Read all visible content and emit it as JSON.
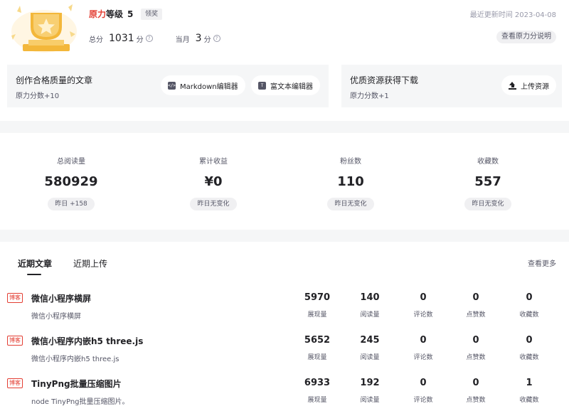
{
  "level": {
    "title_red": "原力",
    "title_rest": "等级",
    "level_num": "5",
    "badge": "领奖",
    "total_label": "总分",
    "total_value": "1031",
    "unit": "分",
    "month_label": "当月",
    "month_value": "3",
    "updated": "最近更新时间 2023-04-08",
    "explain_btn": "查看原力分说明",
    "help_icon": "?"
  },
  "tasks": [
    {
      "title": "创作合格质量的文章",
      "sub": "原力分数+10",
      "buttons": [
        {
          "label": "Markdown编辑器",
          "icon": "markdown-icon",
          "glyph": "</>"
        },
        {
          "label": "富文本编辑器",
          "icon": "richtext-icon",
          "glyph": "T"
        }
      ]
    },
    {
      "title": "优质资源获得下载",
      "sub": "原力分数+1",
      "buttons": [
        {
          "label": "上传资源",
          "icon": "upload-icon"
        }
      ]
    }
  ],
  "stats": [
    {
      "label": "总阅读量",
      "value": "580929",
      "delta": "昨日 +158"
    },
    {
      "label": "累计收益",
      "value": "¥0",
      "delta": "昨日无变化"
    },
    {
      "label": "粉丝数",
      "value": "110",
      "delta": "昨日无变化"
    },
    {
      "label": "收藏数",
      "value": "557",
      "delta": "昨日无变化"
    }
  ],
  "articles": {
    "tabs": [
      "近期文章",
      "近期上传"
    ],
    "more": "查看更多",
    "metric_labels": [
      "展现量",
      "阅读量",
      "评论数",
      "点赞数",
      "收藏数"
    ],
    "items": [
      {
        "tag": "博客",
        "title": "微信小程序横屏",
        "sub": "微信小程序横屏",
        "metrics": [
          "5970",
          "140",
          "0",
          "0",
          "0"
        ]
      },
      {
        "tag": "博客",
        "title": "微信小程序内嵌h5 three.js",
        "sub": "微信小程序内嵌h5 three.js",
        "metrics": [
          "5652",
          "245",
          "0",
          "0",
          "0"
        ]
      },
      {
        "tag": "博客",
        "title": "TinyPng批量压缩图片",
        "sub": "node TinyPng批量压缩图片。",
        "metrics": [
          "6933",
          "192",
          "0",
          "0",
          "1"
        ]
      }
    ]
  },
  "colors": {
    "accent_red": "#e33e33",
    "trophy_gold": "#f3b73a"
  }
}
